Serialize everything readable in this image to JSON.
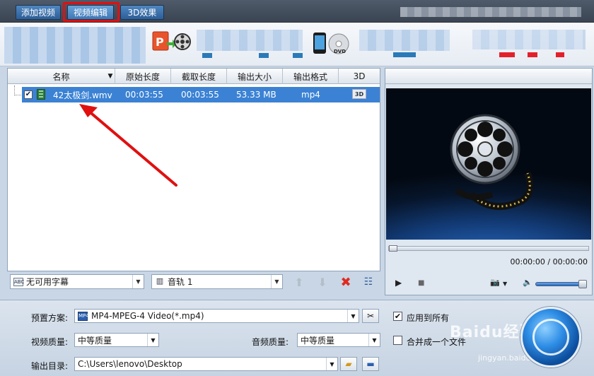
{
  "toolbar": {
    "add_video": "添加视频",
    "video_edit": "视频编辑",
    "effect_3d": "3D效果"
  },
  "file_list": {
    "columns": {
      "name": "名称",
      "original_length": "原始长度",
      "cut_length": "截取长度",
      "output_size": "输出大小",
      "output_format": "输出格式",
      "three_d": "3D"
    },
    "rows": [
      {
        "checked": "✔",
        "name": "42太极剑.wmv",
        "original_length": "00:03:55",
        "cut_length": "00:03:55",
        "output_size": "53.33 MB",
        "output_format": "mp4",
        "three_d_badge": "3D"
      }
    ]
  },
  "list_controls": {
    "subtitle_select": "无可用字幕",
    "subtitle_icon_text": "ABC",
    "audio_select": "音轨 1"
  },
  "preview": {
    "timecode": "00:00:00 / 00:00:00",
    "play_icon": "▶",
    "stop_icon": "■",
    "camera_icon": "📷",
    "volume_icon": "🔈"
  },
  "settings": {
    "preset_label": "预置方案:",
    "preset_value": "MP4-MPEG-4 Video(*.mp4)",
    "preset_icon_text": "MP4",
    "apply_all_label": "应用到所有",
    "apply_all_checked": "✔",
    "video_quality_label": "视频质量:",
    "video_quality_value": "中等质量",
    "audio_quality_label": "音频质量:",
    "audio_quality_value": "中等质量",
    "merge_label": "合并成一个文件",
    "output_dir_label": "输出目录:",
    "output_dir_value": "C:\\Users\\lenovo\\Desktop"
  },
  "watermark": {
    "brand": "Baidu经验",
    "url": "jingyan.baidu.com"
  },
  "colors": {
    "selection": "#3b82d4",
    "toolbar_button": "#2d5f99",
    "annotation_red": "#e01010",
    "convert_button": "#2f8ee6"
  }
}
